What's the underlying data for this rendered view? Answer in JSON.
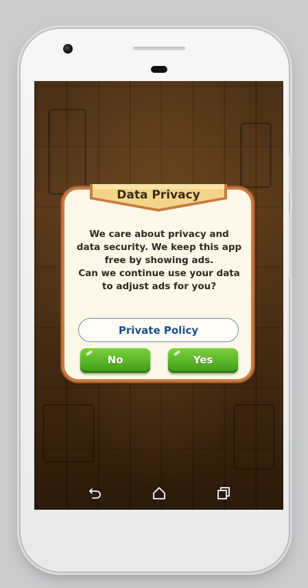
{
  "dialog": {
    "title": "Data Privacy",
    "message": "We care about privacy and\ndata security. We keep this app\nfree by showing ads.\nCan we continue use your data\nto adjust ads for you?",
    "policy_button": "Private Policy",
    "no_button": "No",
    "yes_button": "Yes"
  },
  "navbar": {
    "icons": [
      "back-icon",
      "home-icon",
      "recents-icon"
    ]
  },
  "colors": {
    "dialog_bg": "#fdf8e7",
    "dialog_border": "#c97a44",
    "ribbon": "#f3d58a",
    "button_green": "#5cb72a",
    "policy_text": "#1b4f8c"
  }
}
